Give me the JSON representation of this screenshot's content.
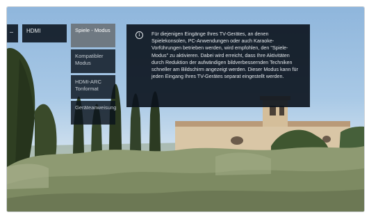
{
  "menu": {
    "breadcrumb_collapsed": "",
    "level1_selected": "HDMI",
    "level2_items": [
      {
        "label": "Spiele - Modus",
        "selected": true
      },
      {
        "label": "Kompatibler Modus",
        "selected": false
      },
      {
        "label": "HDMI-ARC Tonformat",
        "selected": false
      },
      {
        "label": "Geräteanweisung",
        "selected": false
      }
    ]
  },
  "info": {
    "icon": "info-icon",
    "text": "Für diejenigen Eingänge Ihres TV-Gerätes, an denen Spielekonsolen, PC-Anwendungen oder auch Karaoke-Vorführungen betrieben werden, wird empfohlen, den \"Spiele-Modus\" zu aktivieren. Dabei wird erreicht, dass Ihre Aktivitäten durch Reduktion der aufwändigen bildverbessernden Techniken schneller am Bildschirm angezeigt werden. Dieser Modus kann für jeden Eingang Ihres TV-Gerätes separat eingestellt werden."
  },
  "colors": {
    "panel": "#0a121c",
    "selected_item": "#6f7982",
    "text": "#e6eaee"
  }
}
